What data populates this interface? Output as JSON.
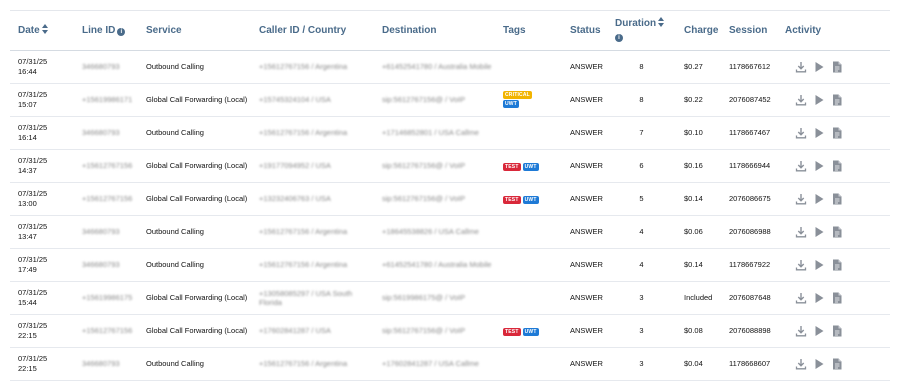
{
  "headers": {
    "date": "Date",
    "line_id": "Line ID",
    "service": "Service",
    "caller_id": "Caller ID / Country",
    "destination": "Destination",
    "tags": "Tags",
    "status": "Status",
    "duration": "Duration",
    "charge": "Charge",
    "session": "Session",
    "activity": "Activity"
  },
  "colors": {
    "header_text": "#4a6b8a",
    "tag_critical": "#f2b400",
    "tag_uwt": "#1e7ad6",
    "tag_test": "#d9283a",
    "icon": "#8a9099"
  },
  "icons": [
    "download-icon",
    "play-icon",
    "document-icon"
  ],
  "rows": [
    {
      "date": "07/31/25",
      "time": "16:44",
      "line_id": "346680793",
      "service": "Outbound Calling",
      "caller": "+15612767156 / Argentina",
      "destination": "+61452541780 / Australia Mobile",
      "tags": [],
      "status": "ANSWER",
      "duration": "8",
      "charge": "$0.27",
      "session": "1178667612"
    },
    {
      "date": "07/31/25",
      "time": "15:07",
      "line_id": "+15619986171",
      "service": "Global Call Forwarding (Local)",
      "caller": "+15745324104 / USA",
      "destination": "sip:5612767156@ / VoIP",
      "tags": [
        {
          "text": "CRITICAL",
          "kind": "critical"
        },
        {
          "text": "UWT",
          "kind": "uwt"
        }
      ],
      "status": "ANSWER",
      "duration": "8",
      "charge": "$0.22",
      "session": "2076087452"
    },
    {
      "date": "07/31/25",
      "time": "16:14",
      "line_id": "346680793",
      "service": "Outbound Calling",
      "caller": "+15612767156 / Argentina",
      "destination": "+17146852801 / USA Callme",
      "tags": [],
      "status": "ANSWER",
      "duration": "7",
      "charge": "$0.10",
      "session": "1178667467"
    },
    {
      "date": "07/31/25",
      "time": "14:37",
      "line_id": "+15612767156",
      "service": "Global Call Forwarding (Local)",
      "caller": "+19177094952 / USA",
      "destination": "sip:5612767156@ / VoIP",
      "tags": [
        {
          "text": "TEST",
          "kind": "test"
        },
        {
          "text": "UWT",
          "kind": "uwt"
        }
      ],
      "status": "ANSWER",
      "duration": "6",
      "charge": "$0.16",
      "session": "1178666944"
    },
    {
      "date": "07/31/25",
      "time": "13:00",
      "line_id": "+15612767156",
      "service": "Global Call Forwarding (Local)",
      "caller": "+13232406763 / USA",
      "destination": "sip:5612767156@ / VoIP",
      "tags": [
        {
          "text": "TEST",
          "kind": "test"
        },
        {
          "text": "UWT",
          "kind": "uwt"
        }
      ],
      "status": "ANSWER",
      "duration": "5",
      "charge": "$0.14",
      "session": "2076086675"
    },
    {
      "date": "07/31/25",
      "time": "13:47",
      "line_id": "346680793",
      "service": "Outbound Calling",
      "caller": "+15612767156 / Argentina",
      "destination": "+18645538826 / USA Callme",
      "tags": [],
      "status": "ANSWER",
      "duration": "4",
      "charge": "$0.06",
      "session": "2076086988"
    },
    {
      "date": "07/31/25",
      "time": "17:49",
      "line_id": "346680793",
      "service": "Outbound Calling",
      "caller": "+15612767156 / Argentina",
      "destination": "+61452541780 / Australia Mobile",
      "tags": [],
      "status": "ANSWER",
      "duration": "4",
      "charge": "$0.14",
      "session": "1178667922"
    },
    {
      "date": "07/31/25",
      "time": "15:44",
      "line_id": "+15619986175",
      "service": "Global Call Forwarding (Local)",
      "caller": "+13058085297 / USA South Florida",
      "destination": "sip:5619986175@ / VoIP",
      "tags": [],
      "status": "ANSWER",
      "duration": "3",
      "charge": "Included",
      "session": "2076087648"
    },
    {
      "date": "07/31/25",
      "time": "22:15",
      "line_id": "+15612767156",
      "service": "Global Call Forwarding (Local)",
      "caller": "+17602841287 / USA",
      "destination": "sip:5612767156@ / VoIP",
      "tags": [
        {
          "text": "TEST",
          "kind": "test"
        },
        {
          "text": "UWT",
          "kind": "uwt"
        }
      ],
      "status": "ANSWER",
      "duration": "3",
      "charge": "$0.08",
      "session": "2076088898"
    },
    {
      "date": "07/31/25",
      "time": "22:15",
      "line_id": "346680793",
      "service": "Outbound Calling",
      "caller": "+15612767156 / Argentina",
      "destination": "+17602841287 / USA Callme",
      "tags": [],
      "status": "ANSWER",
      "duration": "3",
      "charge": "$0.04",
      "session": "1178668607"
    }
  ]
}
